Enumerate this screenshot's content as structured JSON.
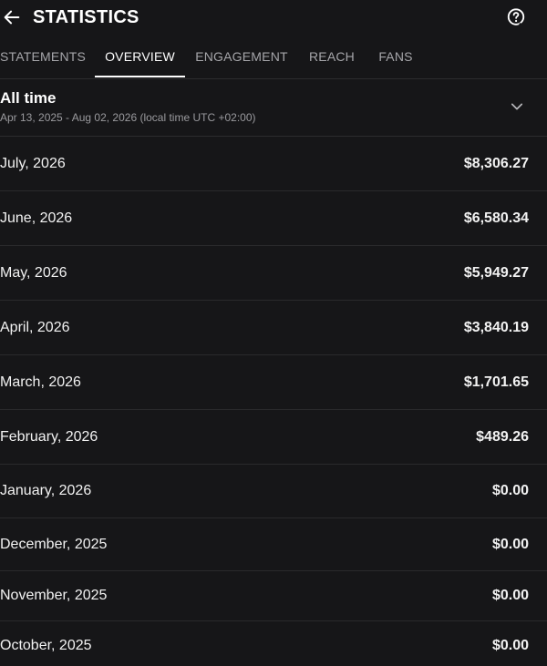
{
  "header": {
    "title": "STATISTICS",
    "back_icon": "arrow-left-icon",
    "help_icon": "help-circle-icon"
  },
  "tabs": [
    {
      "label": "STATEMENTS",
      "active": false
    },
    {
      "label": "OVERVIEW",
      "active": true
    },
    {
      "label": "ENGAGEMENT",
      "active": false
    },
    {
      "label": "REACH",
      "active": false
    },
    {
      "label": "FANS",
      "active": false
    }
  ],
  "range": {
    "title": "All time",
    "subtitle": "Apr 13, 2025 - Aug 02, 2026 (local time UTC +02:00)",
    "icon": "chevron-down-icon"
  },
  "rows": [
    {
      "month": "July, 2026",
      "amount": "$8,306.27"
    },
    {
      "month": "June, 2026",
      "amount": "$6,580.34"
    },
    {
      "month": "May, 2026",
      "amount": "$5,949.27"
    },
    {
      "month": "April, 2026",
      "amount": "$3,840.19"
    },
    {
      "month": "March, 2026",
      "amount": "$1,701.65"
    },
    {
      "month": "February, 2026",
      "amount": "$489.26"
    },
    {
      "month": "January, 2026",
      "amount": "$0.00"
    },
    {
      "month": "December, 2025",
      "amount": "$0.00"
    },
    {
      "month": "November, 2025",
      "amount": "$0.00"
    },
    {
      "month": "October, 2025",
      "amount": "$0.00"
    }
  ],
  "colors": {
    "background": "#161618",
    "text": "#ffffff",
    "muted": "#a6a6aa",
    "divider": "#2a2a2c"
  }
}
